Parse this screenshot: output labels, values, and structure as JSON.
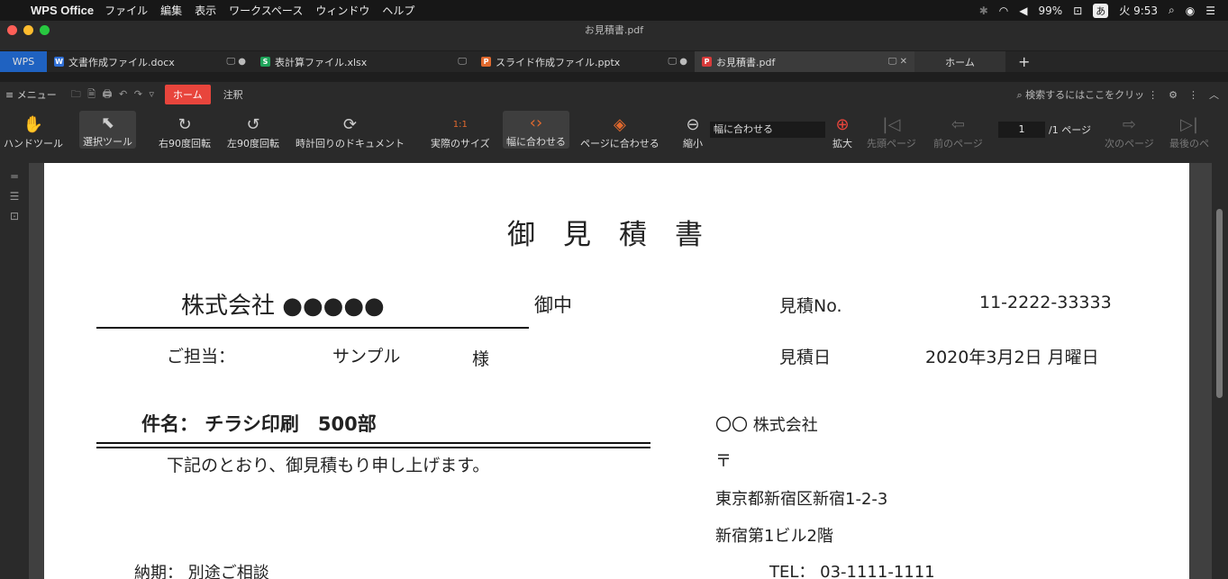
{
  "menubar": {
    "apple": "",
    "app_name": "WPS Office",
    "items": [
      "ファイル",
      "編集",
      "表示",
      "ワークスペース",
      "ウィンドウ",
      "ヘルプ"
    ],
    "bluetooth": "✱",
    "wifi": "◠",
    "volume": "◀",
    "battery": "99%",
    "battery_icon": "⊡",
    "ime": "あ",
    "clock": "火 9:53",
    "search": "⌕",
    "siri": "◉",
    "control": "☰"
  },
  "window": {
    "title": "お見積書.pdf"
  },
  "tabs": [
    {
      "label": "WPS"
    },
    {
      "label": "文書作成ファイル.docx",
      "icon_letter": "W",
      "icon_color": "#2f6fd6",
      "right": "🖵 ●"
    },
    {
      "label": "表計算ファイル.xlsx",
      "icon_letter": "S",
      "icon_color": "#1fa45a",
      "right": "🖵"
    },
    {
      "label": "スライド作成ファイル.pptx",
      "icon_letter": "P",
      "icon_color": "#e0692e",
      "right": "🖵 ●"
    },
    {
      "label": "お見積書.pdf",
      "icon_letter": "P",
      "icon_color": "#d83b3b",
      "right": "🖵 ✕"
    },
    {
      "label": "ホーム"
    }
  ],
  "tab_add": "+",
  "toolbar2": {
    "menu": "≡ メニュー",
    "quick_icons": "🗀 🗎 🖨 ↶ ↷ ▿",
    "home_tab": "ホーム",
    "annotate_tab": "注釈",
    "search_placeholder": "⌕ 検索するにはここをクリッ",
    "more": "⋮",
    "settings": "⚙",
    "more2": "⋮",
    "collapse": "︿"
  },
  "ribbon": {
    "hand": {
      "label": "ハンドツール",
      "icon": "✋"
    },
    "select": {
      "label": "選択ツール",
      "icon": "⬉"
    },
    "rot_right": {
      "label": "右90度回転",
      "icon": "↻"
    },
    "rot_left": {
      "label": "左90度回転",
      "icon": "↺"
    },
    "rot_doc": {
      "label": "時計回りのドキュメント",
      "icon": "⟳"
    },
    "actual": {
      "label": "実際のサイズ",
      "icon": "1:1"
    },
    "fit_width": {
      "label": "幅に合わせる",
      "icon": "‹›"
    },
    "fit_page": {
      "label": "ページに合わせる",
      "icon": "◈"
    },
    "zoom_out": {
      "label": "縮小",
      "icon": "⊖"
    },
    "zoom_value": "幅に合わせる",
    "zoom_in": {
      "label": "拡大",
      "icon": "⊕"
    },
    "first_page": {
      "label": "先頭ページ",
      "icon": "|◁"
    },
    "prev_page": {
      "label": "前のページ",
      "icon": "⇦"
    },
    "page_current": "1",
    "page_total": "/1 ページ",
    "next_page": {
      "label": "次のページ",
      "icon": "⇨"
    },
    "last_page": {
      "label": "最後のペ",
      "icon": "▷|"
    }
  },
  "rail": {
    "icons": [
      "═",
      "☰",
      "⊡"
    ]
  },
  "document": {
    "title": "御　見　積　書",
    "customer": "株式会社 ●●●●●",
    "onchu": "御中",
    "contact_label": "ご担当：",
    "contact_name": "サンプル",
    "sama": "様",
    "quote_no_label": "見積No.",
    "quote_no": "11-2222-33333",
    "date_label": "見積日",
    "date": "2020年3月2日 月曜日",
    "subject": "件名：  チラシ印刷　500部",
    "intro": "下記のとおり、御見積もり申し上げます。",
    "company": "〇〇 株式会社",
    "postal": "〒",
    "address1": "東京都新宿区新宿1-2-3",
    "address2": "新宿第1ビル2階",
    "delivery": "納期：  別途ご相談",
    "tel": "TEL：  03-1111-1111"
  }
}
